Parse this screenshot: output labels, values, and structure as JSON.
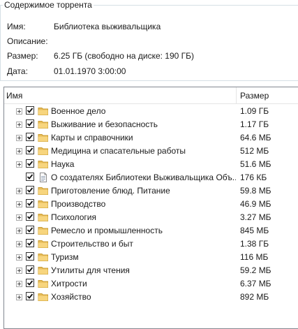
{
  "panel": {
    "title": "Содержимое торрента",
    "name_label": "Имя:",
    "name_value": "Библиотека выживальщика",
    "description_label": "Описание:",
    "description_value": "",
    "size_label": "Размер:",
    "size_value": "6.25 ГБ (свободно на диске: 190 ГБ)",
    "date_label": "Дата:",
    "date_value": "01.01.1970 3:00:00"
  },
  "tree": {
    "columns": [
      "Имя",
      "Размер"
    ],
    "rows": [
      {
        "name": "Военное дело",
        "size": "1.09 ГБ",
        "type": "folder",
        "checked": true
      },
      {
        "name": "Выживание и безопасность",
        "size": "1.17 ГБ",
        "type": "folder",
        "checked": true
      },
      {
        "name": "Карты и справочники",
        "size": "64.6 МБ",
        "type": "folder",
        "checked": true
      },
      {
        "name": "Медицина и спасательные работы",
        "size": "512 МБ",
        "type": "folder",
        "checked": true
      },
      {
        "name": "Наука",
        "size": "51.6 МБ",
        "type": "folder",
        "checked": true
      },
      {
        "name": "О создателях  Библиотеки Выживальщика Объ...",
        "size": "176 КБ",
        "type": "file",
        "checked": true
      },
      {
        "name": "Приготовление блюд. Питание",
        "size": "59.8 МБ",
        "type": "folder",
        "checked": true
      },
      {
        "name": "Производство",
        "size": "46.9 МБ",
        "type": "folder",
        "checked": true
      },
      {
        "name": "Психология",
        "size": "3.27 МБ",
        "type": "folder",
        "checked": true
      },
      {
        "name": "Ремесло и промышленность",
        "size": "845 МБ",
        "type": "folder",
        "checked": true
      },
      {
        "name": "Строительство и быт",
        "size": "1.38 ГБ",
        "type": "folder",
        "checked": true
      },
      {
        "name": "Туризм",
        "size": "116 МБ",
        "type": "folder",
        "checked": true
      },
      {
        "name": "Утилиты для чтения",
        "size": "59.2 МБ",
        "type": "folder",
        "checked": true
      },
      {
        "name": "Хитрости",
        "size": "6.37 МБ",
        "type": "folder",
        "checked": true
      },
      {
        "name": "Хозяйство",
        "size": "892 МБ",
        "type": "folder",
        "checked": true
      }
    ]
  }
}
